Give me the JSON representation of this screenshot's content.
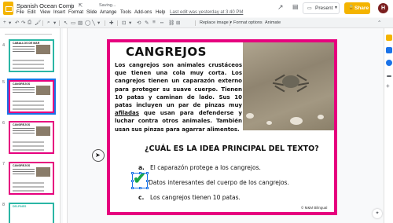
{
  "app": {
    "title": "Spanish Ocean Comp",
    "saving": "Saving...",
    "last_edit": "Last edit was yesterday at 3:40 PM",
    "present_label": "Present",
    "share_label": "Share",
    "avatar_initial": "H",
    "brand_color": "#f4b400"
  },
  "menu": [
    "File",
    "Edit",
    "View",
    "Insert",
    "Format",
    "Slide",
    "Arrange",
    "Tools",
    "Add-ons",
    "Help"
  ],
  "toolbar": {
    "replace_image": "Replace image ▾",
    "format_options": "Format options",
    "animate": "Animate"
  },
  "filmstrip": {
    "numbers": [
      "4",
      "5",
      "6",
      "7",
      "8"
    ],
    "thumb_titles": [
      "CABALLOS DE MAR",
      "CANGREJOS",
      "CANGREJOS",
      "CANGREJOS",
      "DELFINES"
    ]
  },
  "slide": {
    "title": "CANGREJOS",
    "paragraph_before": "Los cangrejos son animales crustáceos que tienen una cola muy corta. Los cangrejos tienen un caparazón externo para proteger su suave cuerpo. Tienen 10 patas y caminan de lado. Sus 10 patas incluyen un par de pinzas muy ",
    "paragraph_underlined": "afiladas",
    "paragraph_after": " que usan para defenderse y luchar contra otros animales. También usan sus pinzas para agarrar alimentos.",
    "question": "¿CUÁL ES LA IDEA PRINCIPAL DEL TEXTO?",
    "options": [
      {
        "letter": "a.",
        "text": "El caparazón protege a los cangrejos."
      },
      {
        "letter": "b.",
        "text": "Datos interesantes del cuerpo de los cangrejos."
      },
      {
        "letter": "c.",
        "text": "Los cangrejos tienen 10 patas."
      }
    ],
    "copyright": "© M&M Bilingual",
    "border_color": "#e6007e"
  }
}
